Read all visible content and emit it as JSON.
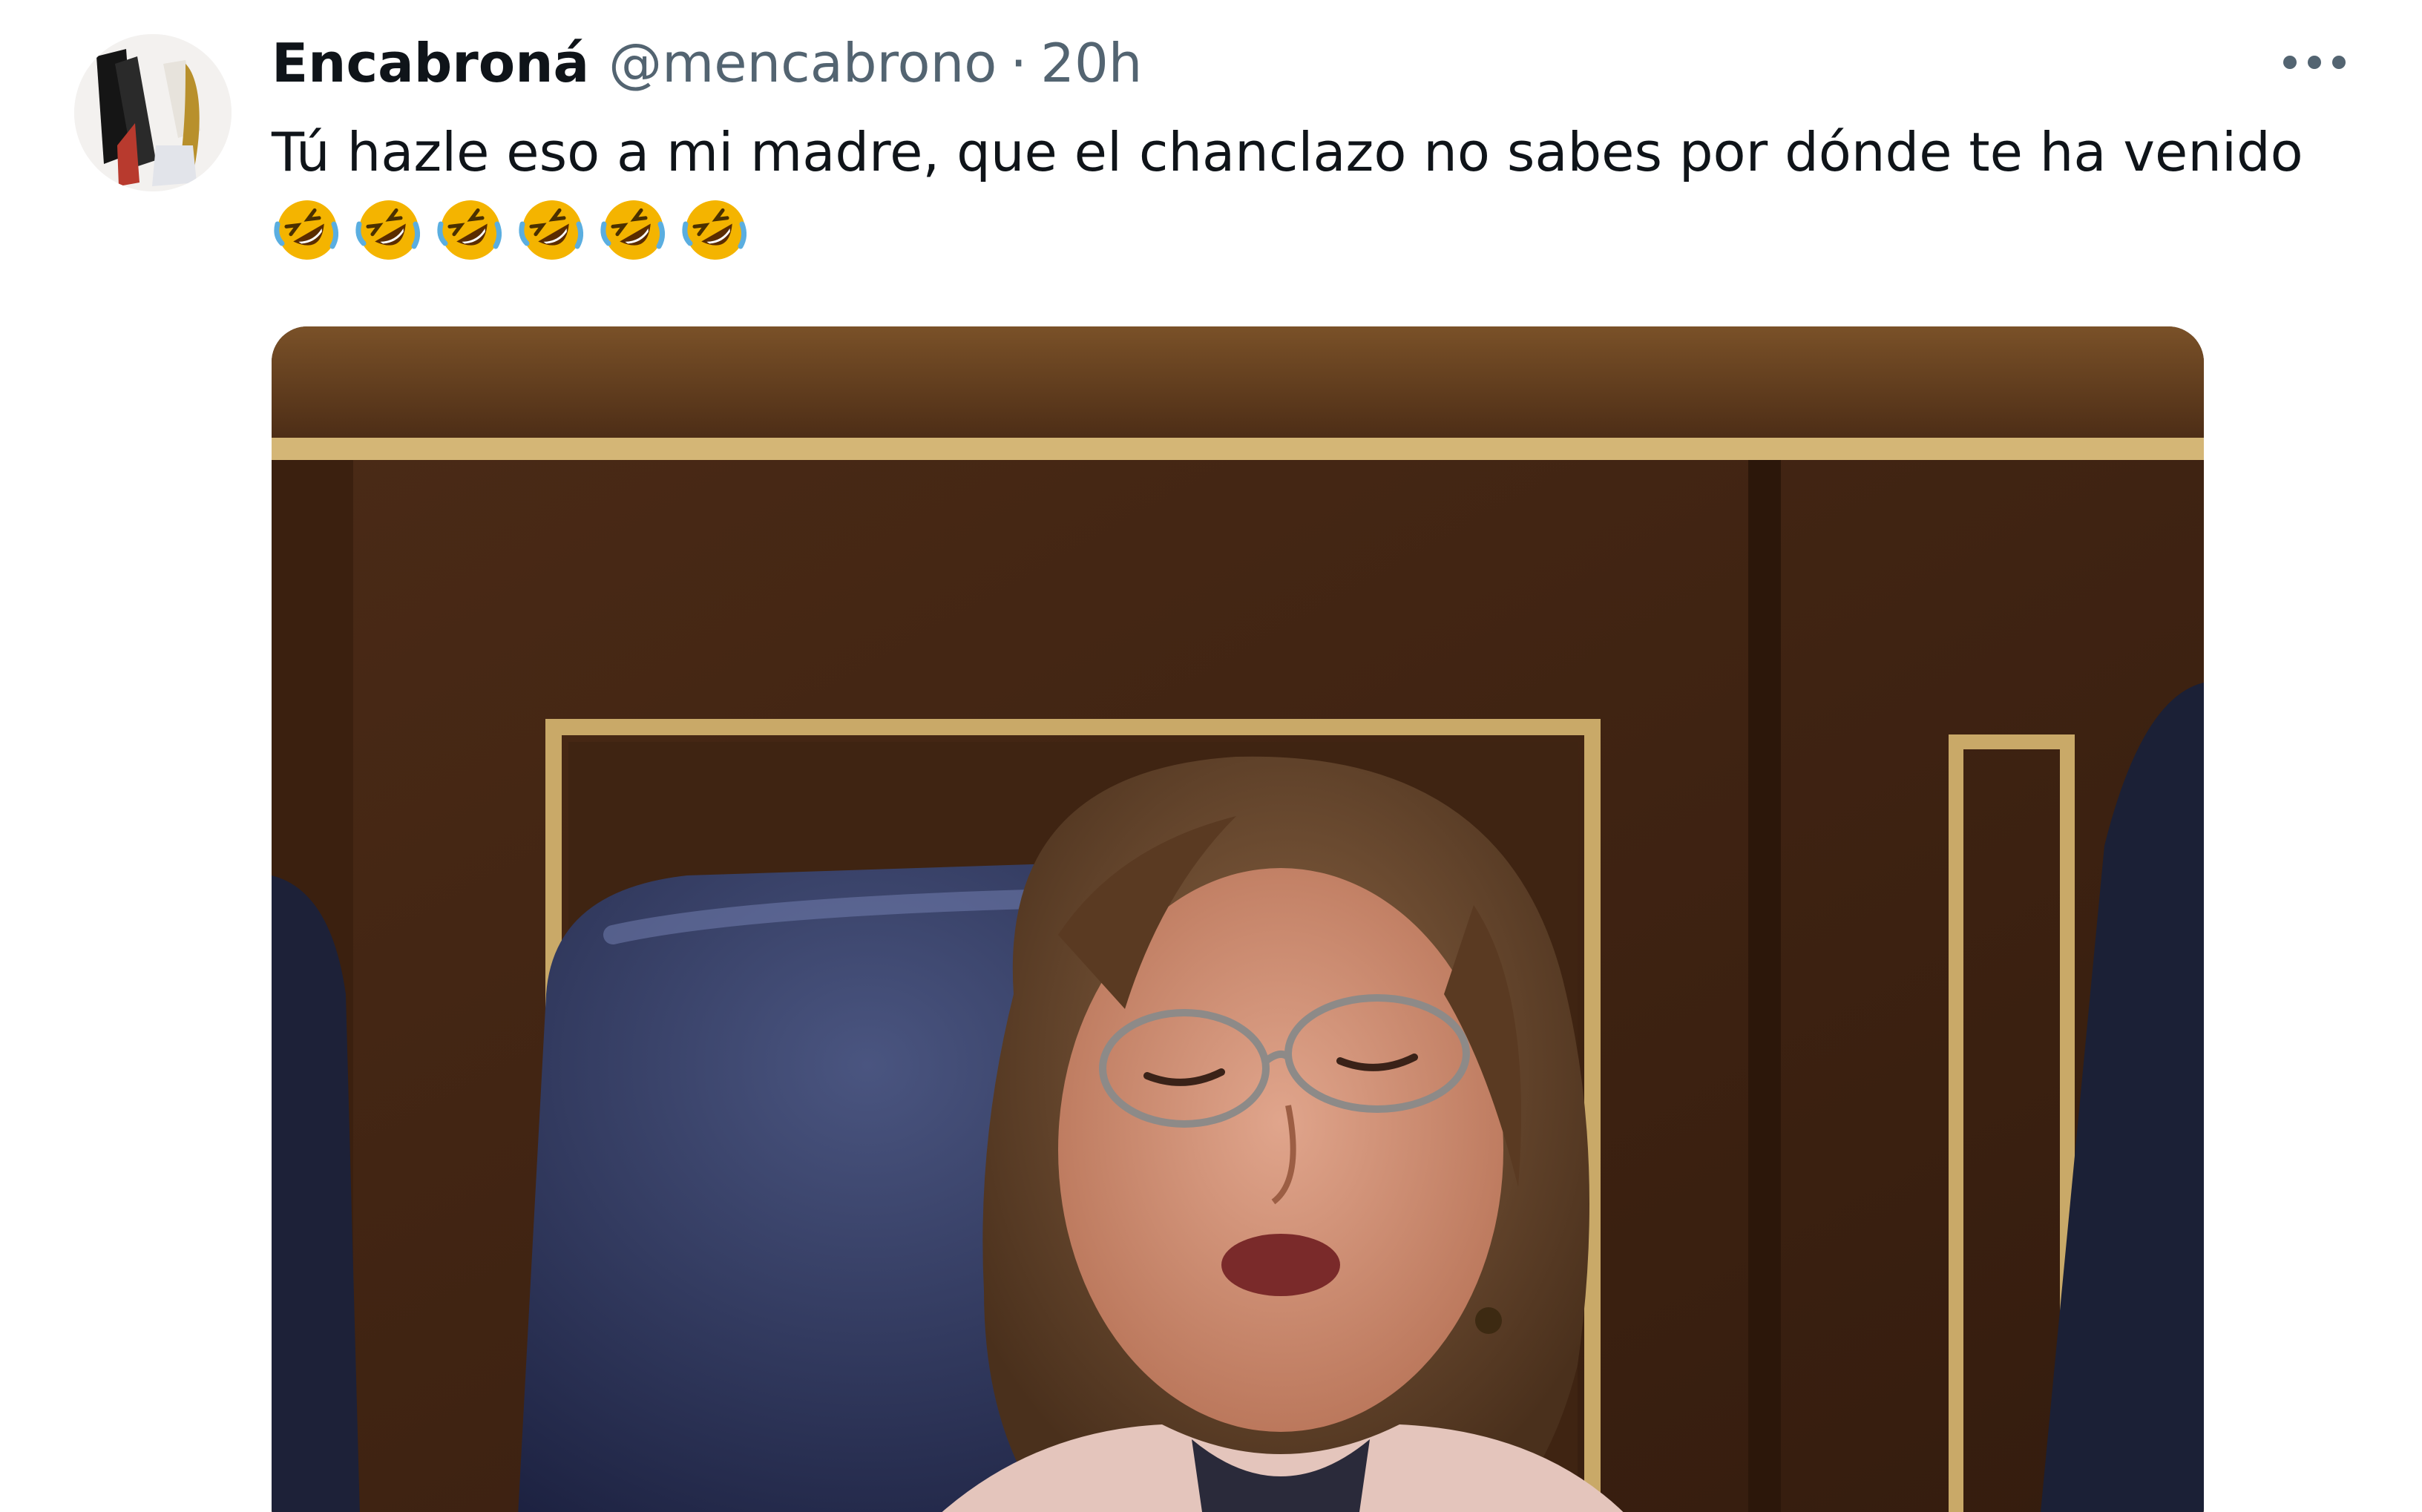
{
  "tweet": {
    "author": {
      "display_name": "Encabroná",
      "handle": "@mencabrono",
      "separator": "·",
      "time": "20h"
    },
    "more_icon": "more-horizontal-icon",
    "text": "Tú hazle eso a mi madre, que el chanclazo no sabes por dónde te ha venido",
    "emojis": [
      "rolling-on-floor-laughing",
      "rolling-on-floor-laughing",
      "rolling-on-floor-laughing",
      "rolling-on-floor-laughing",
      "rolling-on-floor-laughing",
      "rolling-on-floor-laughing"
    ],
    "emoji_text": "🤣🤣🤣🤣🤣🤣",
    "media": {
      "type": "video-frame"
    }
  },
  "colors": {
    "text_primary": "#0f1419",
    "text_secondary": "#536471",
    "emoji_yellow": "#f4b400",
    "emoji_blue": "#5aaee0",
    "wood_dark": "#3e2414",
    "wood_mid": "#6b4526",
    "gold_trim": "#c9a968",
    "seat_navy": "#2c3457"
  }
}
